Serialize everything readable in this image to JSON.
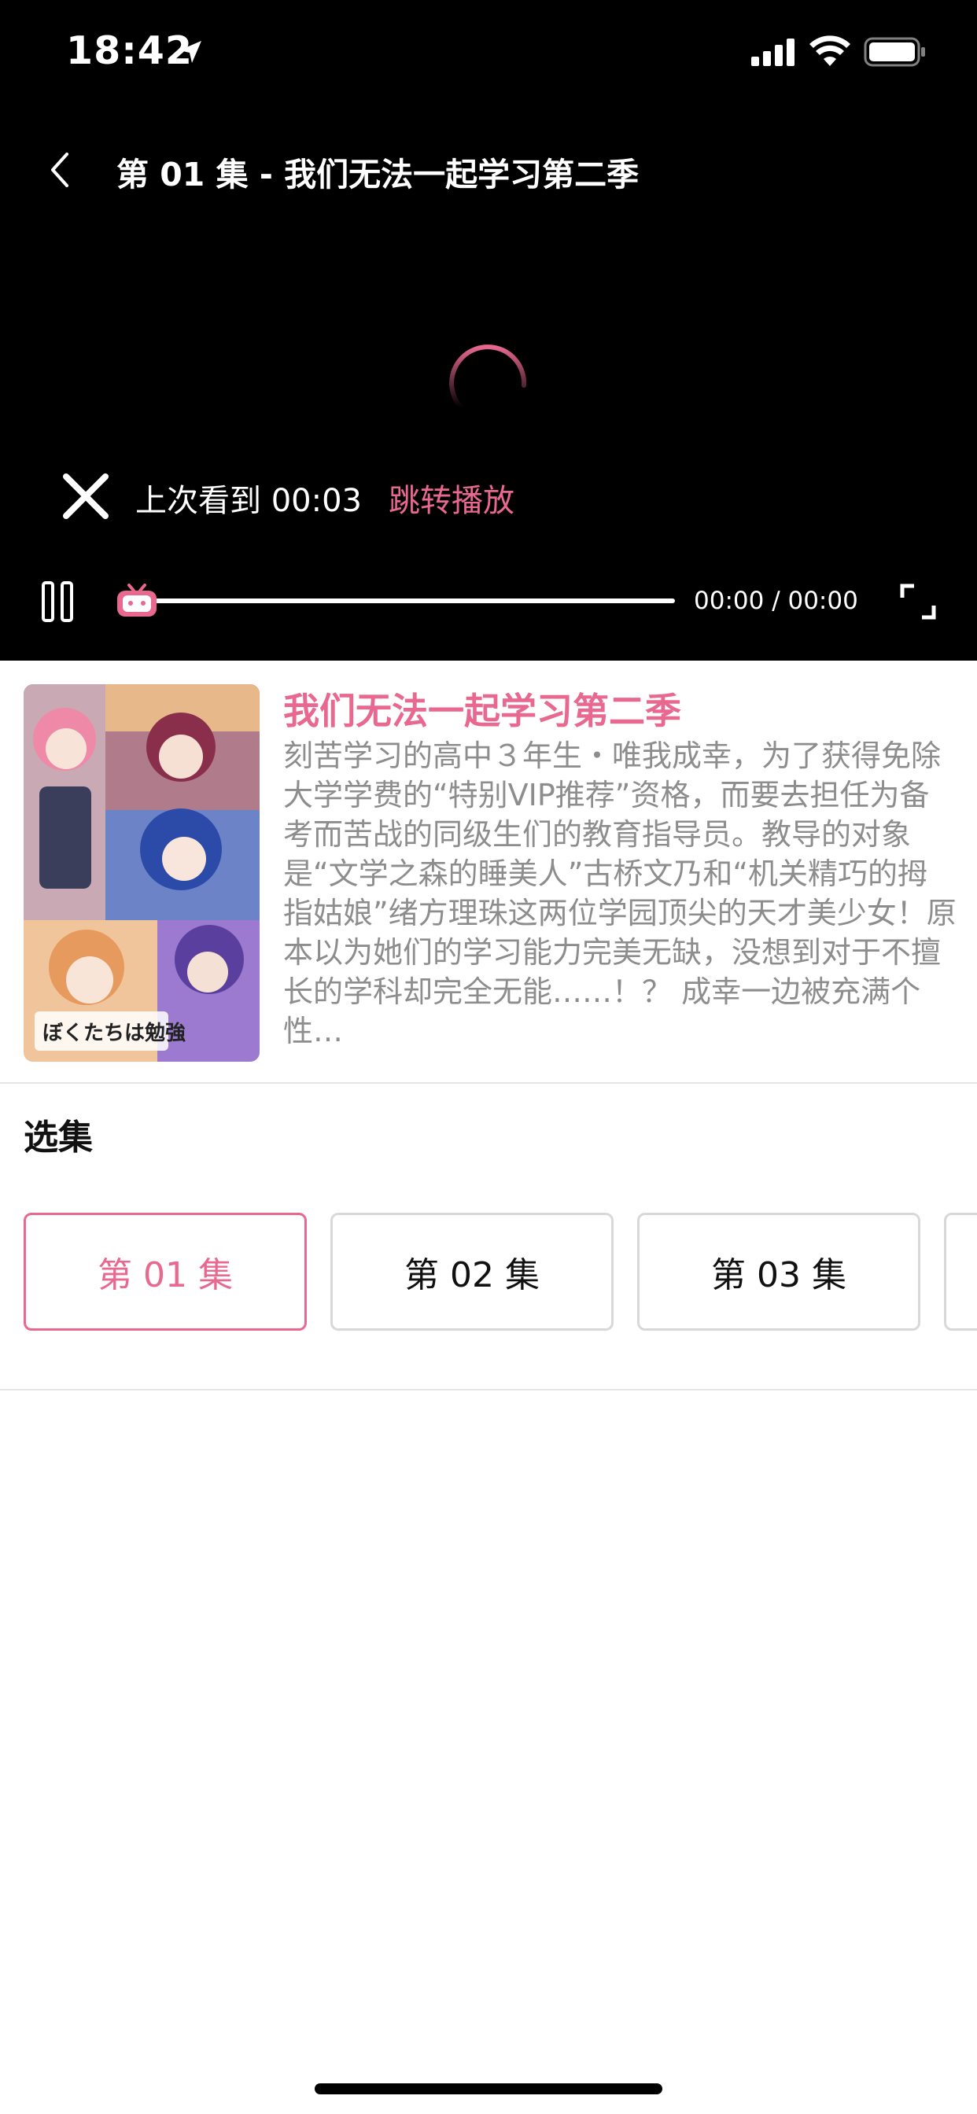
{
  "status_bar": {
    "time": "18:42"
  },
  "player": {
    "title": "第 01 集 - 我们无法一起学习第二季",
    "resume": {
      "text": "上次看到 00:03",
      "jump_label": "跳转播放"
    },
    "time_readout": "00:00 / 00:00",
    "progress_fraction": 0,
    "accent_color": "#e8688f"
  },
  "info": {
    "title": "我们无法一起学习第二季",
    "description": "刻苦学习的高中３年生・唯我成幸，为了获得免除大学学费的“特别VIP推荐”资格，而要去担任为备考而苦战的同级生们的教育指导员。教导的对象是“文学之森的睡美人”古桥文乃和“机关精巧的拇指姑娘”绪方理珠这两位学园顶尖的天才美少女！原本以为她们的学习能力完美无缺，没想到对于不擅长的学科却完全无能……！？ 成幸一边被充满个性…",
    "poster_text": "ぼくたちは勉強ができない"
  },
  "episodes": {
    "heading": "选集",
    "items": [
      {
        "label": "第 01 集",
        "active": true
      },
      {
        "label": "第 02 集",
        "active": false
      },
      {
        "label": "第 03 集",
        "active": false
      }
    ]
  },
  "icons": {
    "back": "chevron-left-icon",
    "close": "close-icon",
    "pause": "pause-icon",
    "fullscreen": "fullscreen-icon",
    "spinner": "loading-spinner-icon"
  }
}
